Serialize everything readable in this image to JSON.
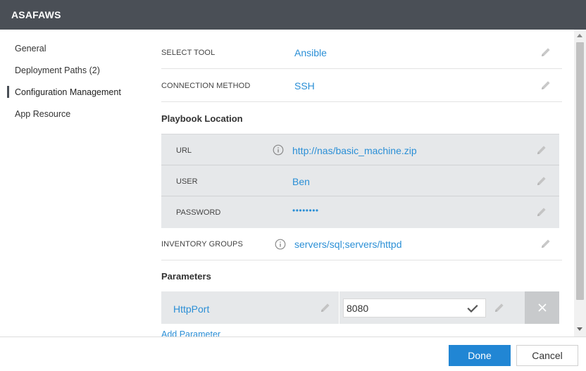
{
  "window": {
    "title": "ASAFAWS"
  },
  "sidebar": {
    "items": [
      {
        "label": "General",
        "active": false
      },
      {
        "label": "Deployment Paths (2)",
        "active": false
      },
      {
        "label": "Configuration Management",
        "active": true
      },
      {
        "label": "App Resource",
        "active": false
      }
    ]
  },
  "config": {
    "select_tool": {
      "label": "SELECT TOOL",
      "value": "Ansible"
    },
    "connection_method": {
      "label": "CONNECTION METHOD",
      "value": "SSH"
    },
    "playbook": {
      "title": "Playbook Location",
      "url": {
        "label": "URL",
        "value": "http://nas/basic_machine.zip"
      },
      "user": {
        "label": "USER",
        "value": "Ben"
      },
      "password": {
        "label": "PASSWORD",
        "value": "••••••••"
      }
    },
    "inventory_groups": {
      "label": "INVENTORY GROUPS",
      "value": "servers/sql;servers/httpd"
    },
    "parameters": {
      "title": "Parameters",
      "items": [
        {
          "name": "HttpPort",
          "value": "8080"
        }
      ],
      "add_label": "Add Parameter"
    }
  },
  "footer": {
    "done_label": "Done",
    "cancel_label": "Cancel"
  },
  "icons": {
    "edit": "pencil-icon",
    "info": "info-icon",
    "confirm": "check-icon",
    "delete": "close-icon"
  },
  "colors": {
    "titlebar": "#4a4f56",
    "link": "#2b8fd6",
    "primary_button": "#2186d4",
    "panel": "#e6e8ea"
  }
}
